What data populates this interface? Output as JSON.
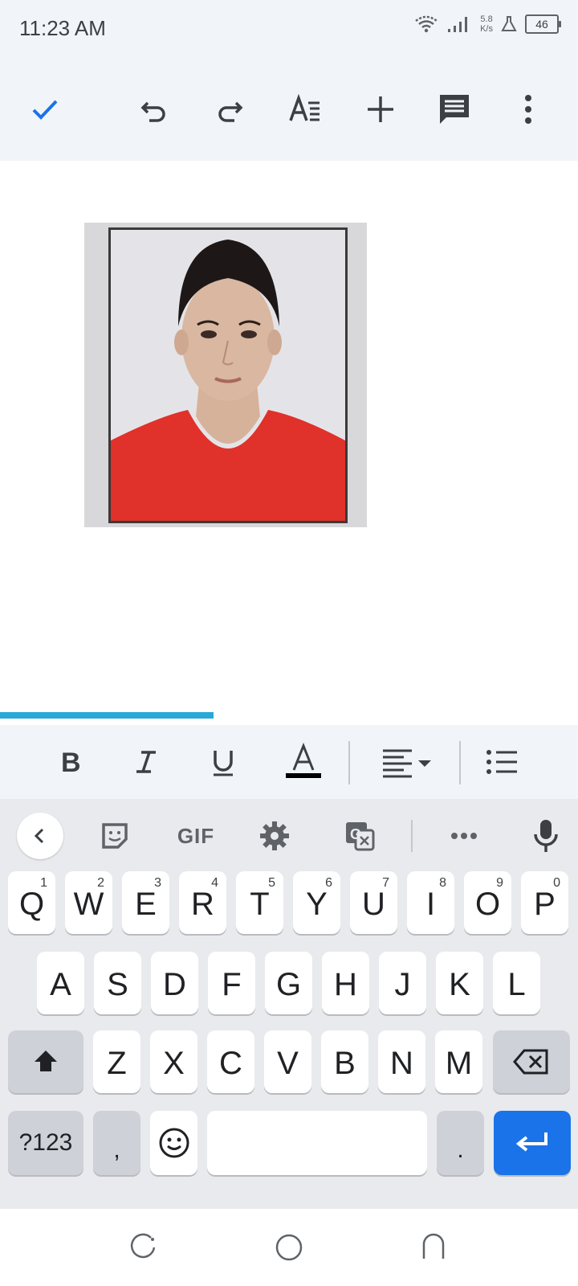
{
  "status": {
    "time": "11:23 AM",
    "speed_value": "5.8",
    "speed_unit": "K/s",
    "battery": "46"
  },
  "toolbar": {
    "icons": [
      "check-icon",
      "undo-icon",
      "redo-icon",
      "text-format-icon",
      "add-icon",
      "comment-icon",
      "more-vert-icon"
    ]
  },
  "document": {
    "image": "passport-photo"
  },
  "progress": {
    "fraction": 0.37
  },
  "format_bar": {
    "icons": [
      "bold-icon",
      "italic-icon",
      "underline-icon",
      "text-color-icon",
      "align-left-icon",
      "bullet-list-icon"
    ],
    "text_color": "#000000"
  },
  "keyboard": {
    "suggestion_icons": [
      "back-icon",
      "sticker-icon",
      "gif-icon",
      "settings-icon",
      "translate-icon",
      "more-horiz-icon",
      "mic-icon"
    ],
    "gif_label": "GIF",
    "row1": [
      {
        "label": "Q",
        "hint": "1"
      },
      {
        "label": "W",
        "hint": "2"
      },
      {
        "label": "E",
        "hint": "3"
      },
      {
        "label": "R",
        "hint": "4"
      },
      {
        "label": "T",
        "hint": "5"
      },
      {
        "label": "Y",
        "hint": "6"
      },
      {
        "label": "U",
        "hint": "7"
      },
      {
        "label": "I",
        "hint": "8"
      },
      {
        "label": "O",
        "hint": "9"
      },
      {
        "label": "P",
        "hint": "0"
      }
    ],
    "row2": [
      "A",
      "S",
      "D",
      "F",
      "G",
      "H",
      "J",
      "K",
      "L"
    ],
    "row3": [
      "Z",
      "X",
      "C",
      "V",
      "B",
      "N",
      "M"
    ],
    "symbols_label": "?123",
    "comma_label": ",",
    "period_label": ".",
    "enter_color": "#1a73e8"
  },
  "nav": {
    "icons": [
      "recents-icon",
      "home-icon",
      "back-nav-icon"
    ]
  }
}
